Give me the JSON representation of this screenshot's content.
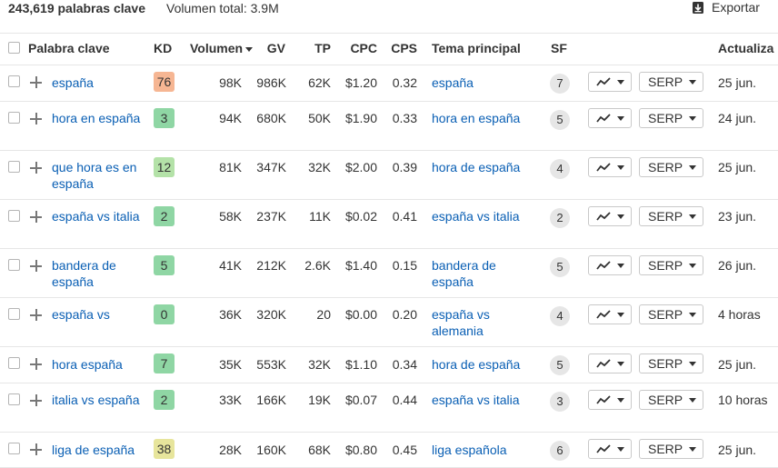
{
  "header": {
    "keyword_count": "243,619 palabras clave",
    "total_volume": "Volumen total: 3.9M",
    "export_label": "Exportar"
  },
  "columns": {
    "keyword": "Palabra clave",
    "kd": "KD",
    "volume": "Volumen",
    "gv": "GV",
    "tp": "TP",
    "cpc": "CPC",
    "cps": "CPS",
    "parent_topic": "Tema principal",
    "sf": "SF",
    "updated": "Actualiza"
  },
  "serp_button_label": "SERP",
  "kd_colors": {
    "high": "#f6b693",
    "low": "#8fd6a4",
    "mid": "#b4e2a8",
    "yellow": "#e7e59c",
    "zero": "#8fd6a4"
  },
  "rows": [
    {
      "keyword": "españa",
      "kd": "76",
      "kd_color": "#f6b693",
      "volume": "98K",
      "gv": "986K",
      "tp": "62K",
      "cpc": "$1.20",
      "cps": "0.32",
      "topic": "españa",
      "sf": "7",
      "updated": "25 jun."
    },
    {
      "keyword": "hora en españa",
      "kd": "3",
      "kd_color": "#8fd6a4",
      "volume": "94K",
      "gv": "680K",
      "tp": "50K",
      "cpc": "$1.90",
      "cps": "0.33",
      "topic": "hora en españa",
      "sf": "5",
      "updated": "24 jun."
    },
    {
      "keyword": "que hora es en españa",
      "kd": "12",
      "kd_color": "#b4e2a8",
      "volume": "81K",
      "gv": "347K",
      "tp": "32K",
      "cpc": "$2.00",
      "cps": "0.39",
      "topic": "hora de españa",
      "sf": "4",
      "updated": "25 jun."
    },
    {
      "keyword": "españa vs italia",
      "kd": "2",
      "kd_color": "#8fd6a4",
      "volume": "58K",
      "gv": "237K",
      "tp": "11K",
      "cpc": "$0.02",
      "cps": "0.41",
      "topic": "españa vs italia",
      "sf": "2",
      "updated": "23 jun."
    },
    {
      "keyword": "bandera de españa",
      "kd": "5",
      "kd_color": "#8fd6a4",
      "volume": "41K",
      "gv": "212K",
      "tp": "2.6K",
      "cpc": "$1.40",
      "cps": "0.15",
      "topic": "bandera de españa",
      "sf": "5",
      "updated": "26 jun."
    },
    {
      "keyword": "españa vs",
      "kd": "0",
      "kd_color": "#8fd6a4",
      "volume": "36K",
      "gv": "320K",
      "tp": "20",
      "cpc": "$0.00",
      "cps": "0.20",
      "topic": "españa vs alemania",
      "sf": "4",
      "updated": "4 horas"
    },
    {
      "keyword": "hora españa",
      "kd": "7",
      "kd_color": "#8fd6a4",
      "volume": "35K",
      "gv": "553K",
      "tp": "32K",
      "cpc": "$1.10",
      "cps": "0.34",
      "topic": "hora de españa",
      "sf": "5",
      "updated": "25 jun."
    },
    {
      "keyword": "italia vs españa",
      "kd": "2",
      "kd_color": "#8fd6a4",
      "volume": "33K",
      "gv": "166K",
      "tp": "19K",
      "cpc": "$0.07",
      "cps": "0.44",
      "topic": "españa vs italia",
      "sf": "3",
      "updated": "10 horas"
    },
    {
      "keyword": "liga de españa",
      "kd": "38",
      "kd_color": "#e7e59c",
      "volume": "28K",
      "gv": "160K",
      "tp": "68K",
      "cpc": "$0.80",
      "cps": "0.45",
      "topic": "liga española",
      "sf": "6",
      "updated": "25 jun."
    }
  ]
}
